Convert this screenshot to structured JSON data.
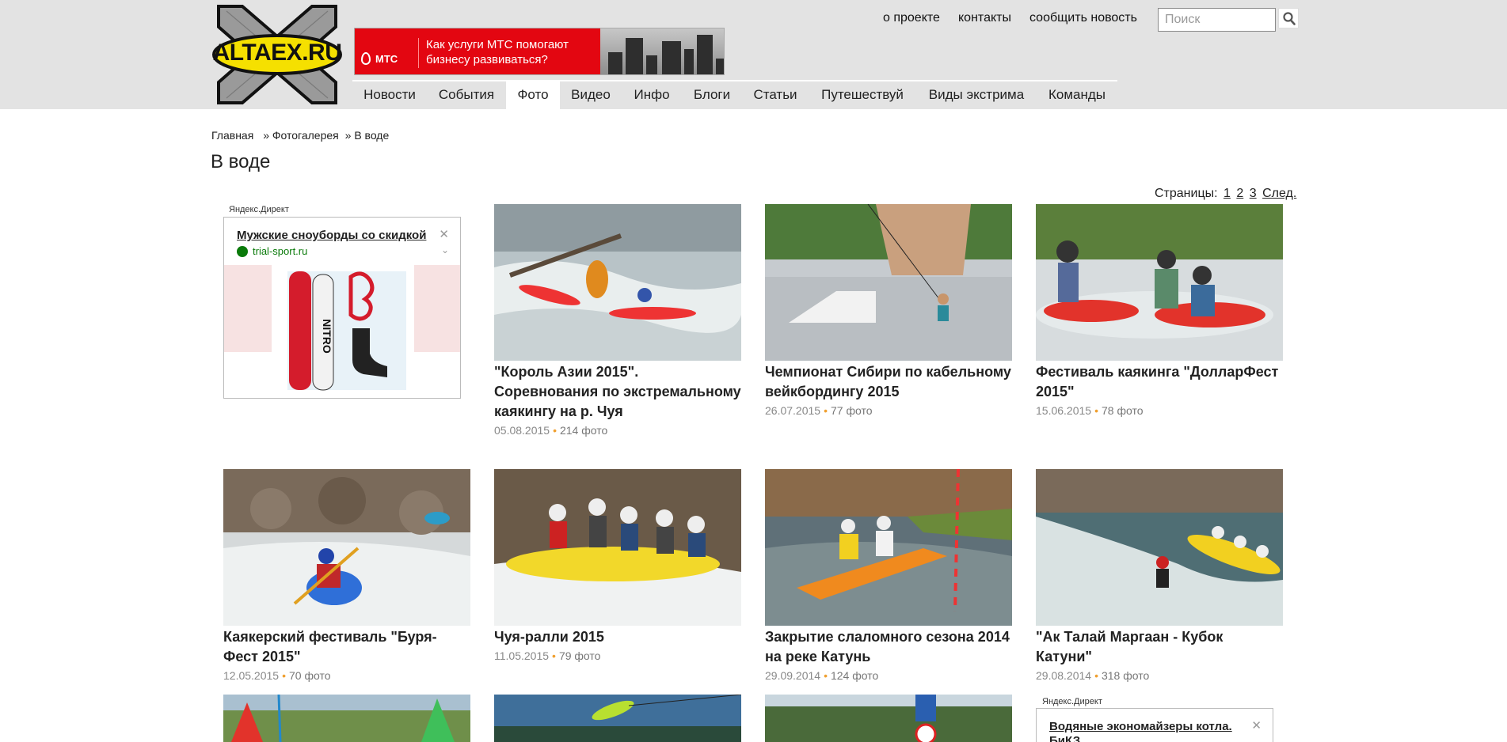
{
  "site": {
    "logo_text": "ALTAEX.RU"
  },
  "banner": {
    "brand": "МТС",
    "text": "Как услуги МТС помогают бизнесу развиваться?"
  },
  "header_links": [
    "о проекте",
    "контакты",
    "сообщить новость"
  ],
  "search": {
    "placeholder": "Поиск"
  },
  "nav": {
    "items": [
      "Новости",
      "События",
      "Фото",
      "Видео",
      "Инфо",
      "Блоги",
      "Статьи",
      "Путешествуй",
      "Виды экстрима",
      "Команды"
    ],
    "active": "Фото"
  },
  "breadcrumb": {
    "home": "Главная",
    "sep": "»",
    "gallery": "Фотогалерея",
    "current": "В воде"
  },
  "page_title": "В воде",
  "pager": {
    "label": "Страницы:",
    "pages": [
      "1",
      "2",
      "3"
    ],
    "next": "След."
  },
  "ads": [
    {
      "label": "Яндекс.Директ",
      "title": "Мужские сноуборды со скидкой",
      "domain": "trial-sport.ru",
      "brand": "NITRO"
    },
    {
      "label": "Яндекс.Директ",
      "title": "Водяные экономайзеры котла.",
      "title2": "БиКЗ."
    }
  ],
  "albums": [
    {
      "title": "\"Король Азии 2015\". Соревнования по экстремальному каякингу на р. Чуя",
      "date": "05.08.2015",
      "count": "214 фото"
    },
    {
      "title": "Чемпионат Сибири по кабельному вейкбордингу 2015",
      "date": "26.07.2015",
      "count": "77 фото"
    },
    {
      "title": "Фестиваль каякинга \"ДолларФест 2015\"",
      "date": "15.06.2015",
      "count": "78 фото"
    },
    {
      "title": "Каякерский фестиваль \"Буря-Фест 2015\"",
      "date": "12.05.2015",
      "count": "70 фото"
    },
    {
      "title": "Чуя-ралли 2015",
      "date": "11.05.2015",
      "count": "79 фото"
    },
    {
      "title": "Закрытие слаломного сезона 2014 на реке Катунь",
      "date": "29.09.2014",
      "count": "124 фото"
    },
    {
      "title": "\"Ак Талай Маргаан - Кубок Катуни\"",
      "date": "29.08.2014",
      "count": "318 фото"
    }
  ],
  "colors": {
    "header_bg": "#e3e3e3",
    "logo_yellow": "#f5e000",
    "mts_red": "#e30611",
    "dot_orange": "#f0a030"
  }
}
